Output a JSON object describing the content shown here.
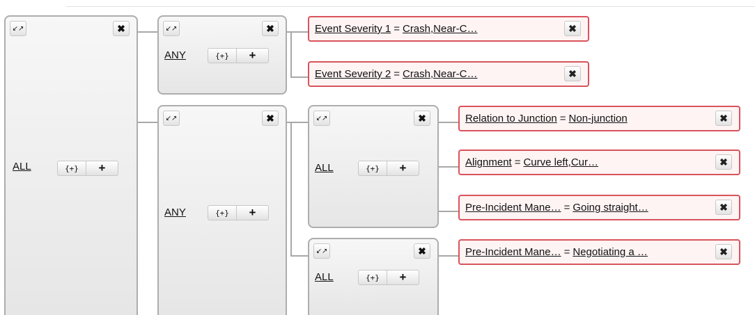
{
  "icons": {
    "collapse": "↙↗",
    "close": "✖",
    "add_group": "{+}",
    "add_rule": "+"
  },
  "groups": {
    "g1": {
      "operator": "ALL"
    },
    "g2": {
      "operator": "ANY"
    },
    "g3": {
      "operator": "ANY"
    },
    "g4": {
      "operator": "ALL"
    },
    "g5": {
      "operator": "ALL"
    }
  },
  "conditions": [
    {
      "field": "Event Severity 1",
      "op": "=",
      "value": "Crash,Near-C…"
    },
    {
      "field": "Event Severity 2",
      "op": "=",
      "value": "Crash,Near-C…"
    },
    {
      "field": "Relation to Junction",
      "op": "=",
      "value": "Non-junction"
    },
    {
      "field": "Alignment",
      "op": "=",
      "value": "Curve left,Cur…"
    },
    {
      "field": "Pre-Incident Mane…",
      "op": "=",
      "value": "Going straight…"
    },
    {
      "field": "Pre-Incident Mane…",
      "op": "=",
      "value": "Negotiating a …"
    }
  ]
}
